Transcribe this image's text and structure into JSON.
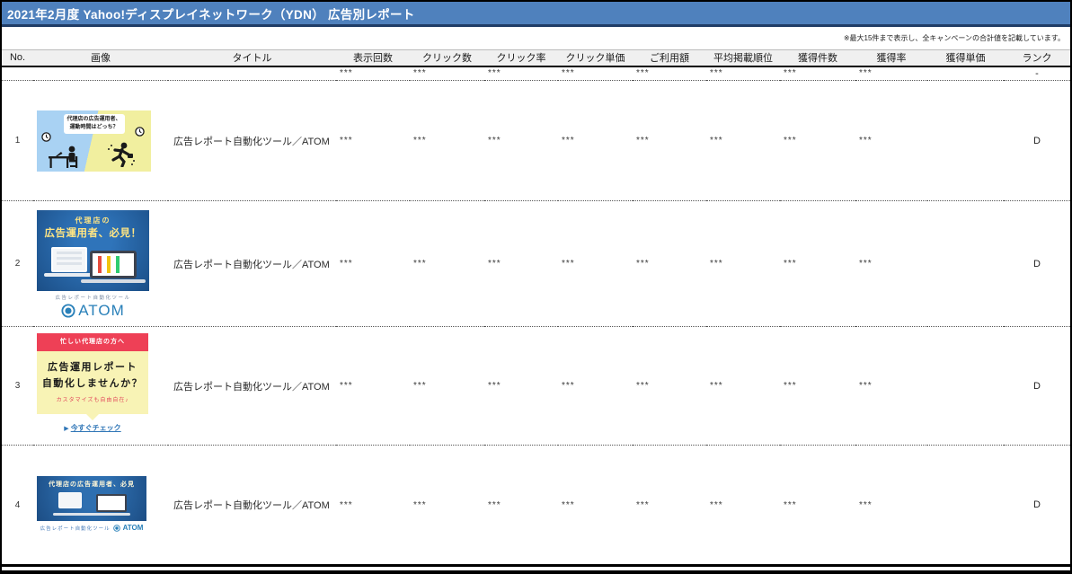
{
  "header": {
    "title": "2021年2月度 Yahoo!ディスプレイネットワーク（YDN） 広告別レポート",
    "note": "※最大15件まで表示し、全キャンペーンの合計値を記載しています。"
  },
  "colors": {
    "titlebar_bg": "#4f81bd",
    "titlebar_underline": "#1f3c66",
    "header_row_bg": "#f0f0f0",
    "ad_blue": "#2465a8",
    "ad_red": "#ee4056",
    "ad_pale_yellow": "#f8f3b5",
    "ad_sky_blue": "#a9d2f3",
    "ad_lemon": "#f1ef9f",
    "atom_brand_blue": "#2980b9",
    "link_blue": "#2e75b6"
  },
  "table": {
    "columns": [
      "No.",
      "画像",
      "タイトル",
      "表示回数",
      "クリック数",
      "クリック率",
      "クリック単価",
      "ご利用額",
      "平均掲載順位",
      "獲得件数",
      "獲得率",
      "獲得単価",
      "ランク"
    ],
    "totals_row": {
      "metrics": [
        "***",
        "***",
        "***",
        "***",
        "***",
        "***",
        "***",
        "***"
      ],
      "acquisition_cost": "",
      "rank": "-"
    },
    "rows": [
      {
        "no": "1",
        "title": "広告レポート自動化ツール／ATOM",
        "metrics": [
          "***",
          "***",
          "***",
          "***",
          "***",
          "***",
          "***",
          "***"
        ],
        "acquisition_cost": "",
        "rank": "D"
      },
      {
        "no": "2",
        "title": "広告レポート自動化ツール／ATOM",
        "metrics": [
          "***",
          "***",
          "***",
          "***",
          "***",
          "***",
          "***",
          "***"
        ],
        "acquisition_cost": "",
        "rank": "D"
      },
      {
        "no": "3",
        "title": "広告レポート自動化ツール／ATOM",
        "metrics": [
          "***",
          "***",
          "***",
          "***",
          "***",
          "***",
          "***",
          "***"
        ],
        "acquisition_cost": "",
        "rank": "D"
      },
      {
        "no": "4",
        "title": "広告レポート自動化ツール／ATOM",
        "metrics": [
          "***",
          "***",
          "***",
          "***",
          "***",
          "***",
          "***",
          "***"
        ],
        "acquisition_cost": "",
        "rank": "D"
      }
    ]
  },
  "ads": {
    "ad1": {
      "bubble_line1": "代理店の広告運用者、",
      "bubble_line2": "運動時間はどっち？"
    },
    "ad2": {
      "headline1": "代理店の",
      "headline2": "広告運用者、必見！",
      "tool_label": "広告レポート自動化ツール",
      "brand": "ATOM"
    },
    "ad3": {
      "ribbon": "忙しい代理店の方へ",
      "headline1": "広告運用レポート",
      "headline2": "自動化しませんか？",
      "sub": "カスタマイズも自由自在♪",
      "cta_icon": "▶",
      "cta": "今すぐチェック"
    },
    "ad4": {
      "headline": "代理店の広告運用者、必見",
      "tool_label": "広告レポート自動化ツール",
      "brand": "ATOM"
    }
  }
}
